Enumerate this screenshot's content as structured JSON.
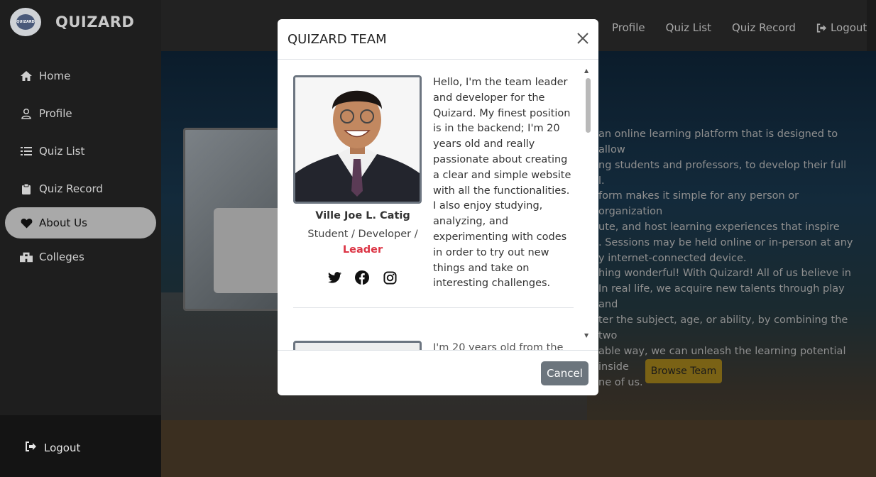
{
  "brand": {
    "name": "QUIZARD",
    "logo_text": "QUIZARD"
  },
  "sidebar": {
    "items": [
      {
        "label": "Home",
        "icon": "home-icon"
      },
      {
        "label": "Profile",
        "icon": "user-icon"
      },
      {
        "label": "Quiz List",
        "icon": "list-icon"
      },
      {
        "label": "Quiz Record",
        "icon": "clipboard-icon"
      },
      {
        "label": "About Us",
        "icon": "heart-icon",
        "active": true
      },
      {
        "label": "Colleges",
        "icon": "building-icon"
      }
    ],
    "logout": "Logout"
  },
  "topnav": {
    "profile": "Profile",
    "quiz_list": "Quiz List",
    "quiz_record": "Quiz Record",
    "logout": "Logout"
  },
  "about": {
    "p1": [
      "an online learning platform that is designed to allow",
      "ng students and professors, to develop their full",
      "l."
    ],
    "p2": [
      "form makes it simple for any person or organization",
      "ute, and host learning experiences that inspire",
      ". Sessions may be held online or in-person at any",
      "y internet-connected device."
    ],
    "p3": [
      "hing wonderful! With Quizard! All of us believe in",
      "In real life, we acquire new talents through play and",
      "ter the subject, age, or ability, by combining the two",
      "able way, we can unleash the learning potential inside",
      "ne of us."
    ],
    "browse_button": "Browse Team"
  },
  "modal": {
    "title": "QUIZARD TEAM",
    "member": {
      "name": "Ville Joe L. Catig",
      "role": "Student / Developer /",
      "badge": "Leader",
      "bio": "Hello, I'm the team leader and developer for the Quizard. My finest position is in the backend; I'm 20 years old and really passionate about creating a clear and simple website with all the functionalities. I also enjoy studying, analyzing, and experimenting with codes in order to try out new things and take on interesting challenges."
    },
    "next_bio_partial": "I'm 20 years old from the",
    "cancel": "Cancel"
  },
  "colors": {
    "accent": "#7a6215",
    "leader": "#dc3545",
    "sidebar_active": "#a9a9a9",
    "cancel": "#6c757d"
  }
}
